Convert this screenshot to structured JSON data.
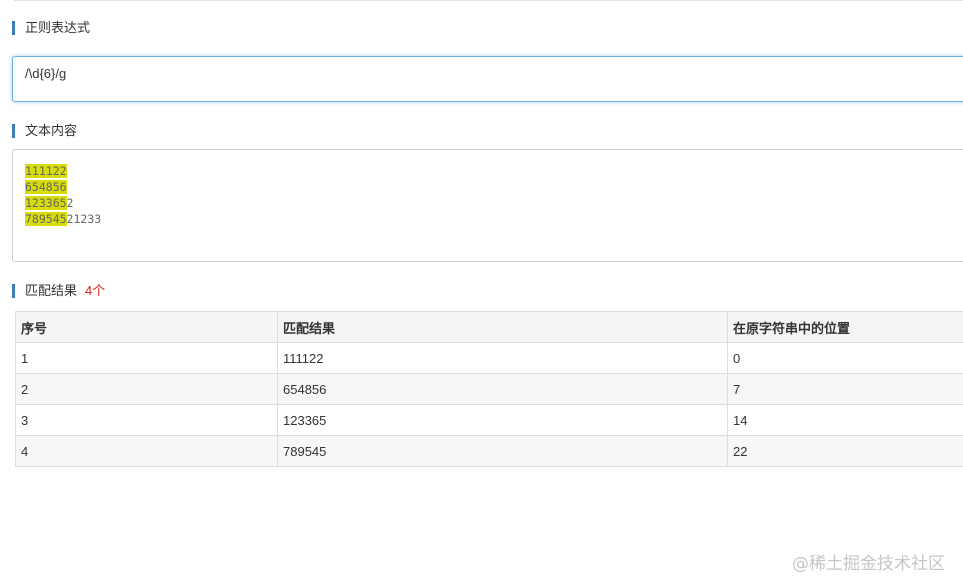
{
  "regex_section": {
    "title": "正则表达式",
    "value": "/\\d{6}/g"
  },
  "text_section": {
    "title": "文本内容",
    "lines": [
      {
        "match": "111122",
        "rest": ""
      },
      {
        "match": "654856",
        "rest": ""
      },
      {
        "match": "123365",
        "rest": "2"
      },
      {
        "match": "789545",
        "rest": "21233"
      }
    ],
    "highlight_color": "#d8dd0a"
  },
  "results_section": {
    "title": "匹配结果",
    "count": "4个",
    "headers": [
      "序号",
      "匹配结果",
      "在原字符串中的位置"
    ],
    "rows": [
      [
        "1",
        "111122",
        "0"
      ],
      [
        "2",
        "654856",
        "7"
      ],
      [
        "3",
        "123365",
        "14"
      ],
      [
        "4",
        "789545",
        "22"
      ]
    ]
  },
  "watermark": "@稀土掘金技术社区",
  "colors": {
    "accent": "#3a7fb8",
    "count": "#d9230f",
    "focus_border": "#66afe9"
  }
}
